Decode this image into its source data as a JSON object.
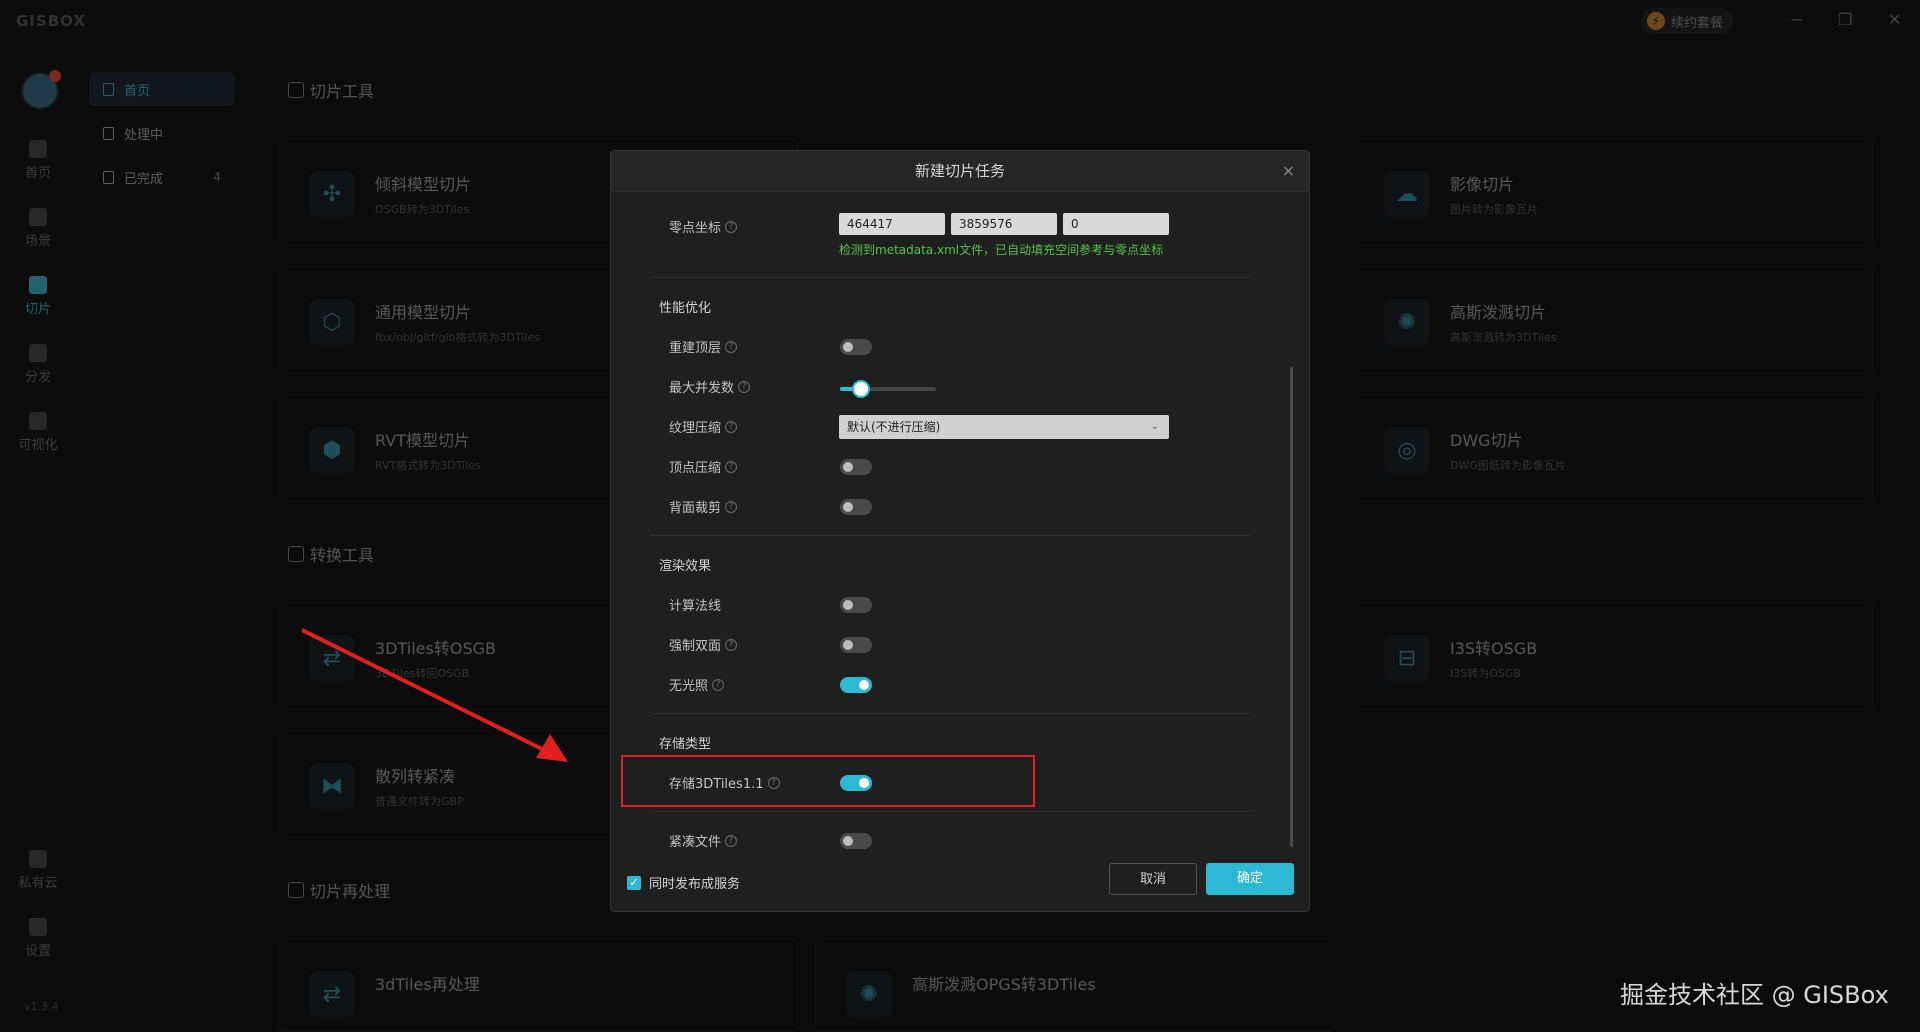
{
  "app": {
    "logo": "GISBOX",
    "package_button": "续约套餐",
    "window_controls": {
      "minimize": "−",
      "restore": "❐",
      "close": "✕"
    },
    "version": "v1.3.4"
  },
  "rail": {
    "items": [
      {
        "label": "首页",
        "icon": "home-icon"
      },
      {
        "label": "场景",
        "icon": "cube-icon"
      },
      {
        "label": "切片",
        "icon": "slice-icon",
        "active": true
      },
      {
        "label": "分发",
        "icon": "distribute-icon"
      },
      {
        "label": "可视化",
        "icon": "visualize-icon"
      }
    ],
    "bottom_items": [
      {
        "label": "私有云",
        "icon": "cloud-icon"
      },
      {
        "label": "设置",
        "icon": "gear-icon"
      }
    ]
  },
  "subnav": {
    "items": [
      {
        "label": "首页",
        "active": true
      },
      {
        "label": "处理中"
      },
      {
        "label": "已完成",
        "count": "4"
      }
    ]
  },
  "main": {
    "sections": {
      "slice_tools": "切片工具",
      "convert_tools": "转换工具",
      "reprocess": "切片再处理"
    },
    "cards": {
      "oblique": {
        "title": "倾斜模型切片",
        "sub": "OSGB转为3DTiles"
      },
      "general": {
        "title": "通用模型切片",
        "sub": "fbx/obj/gltf/glb格式转为3DTiles"
      },
      "rvt": {
        "title": "RVT模型切片",
        "sub": "RVT格式转为3DTiles"
      },
      "image": {
        "title": "影像切片",
        "sub": "图片转为影像瓦片"
      },
      "gaussian": {
        "title": "高斯泼溅切片",
        "sub": "高斯泼溅转为3DTiles"
      },
      "dwg": {
        "title": "DWG切片",
        "sub": "DWG图纸转为影像瓦片"
      },
      "tiles_to_osgb": {
        "title": "3DTiles转OSGB",
        "sub": "3DTiles转回OSGB"
      },
      "i3s": {
        "title": "I3S转OSGB",
        "sub": "I3S转为OSGB"
      },
      "scatter": {
        "title": "散列转紧凑",
        "sub": "普通文件转为GBP"
      },
      "tiles_reprocess": {
        "title": "3dTiles再处理",
        "sub": ""
      },
      "gaussian_opgs": {
        "title": "高斯泼溅OPGS转3DTiles",
        "sub": ""
      }
    }
  },
  "dialog": {
    "title": "新建切片任务",
    "close": "×",
    "origin": {
      "label": "零点坐标",
      "x": "464417",
      "y": "3859576",
      "z": "0",
      "hint": "检测到metadata.xml文件，已自动填充空间参考与零点坐标"
    },
    "perf": {
      "title": "性能优化",
      "rebuild_top": {
        "label": "重建顶层",
        "on": false
      },
      "max_concurrency": {
        "label": "最大并发数",
        "level": 0.22
      },
      "texture": {
        "label": "纹理压缩",
        "value": "默认(不进行压缩)"
      },
      "vertex": {
        "label": "顶点压缩",
        "on": false
      },
      "backface": {
        "label": "背面裁剪",
        "on": false
      }
    },
    "render": {
      "title": "渲染效果",
      "normals": {
        "label": "计算法线",
        "on": false
      },
      "double_sided": {
        "label": "强制双面",
        "on": false
      },
      "unlit": {
        "label": "无光照",
        "on": true
      }
    },
    "storage": {
      "title": "存储类型",
      "tiles11": {
        "label": "存储3DTiles1.1",
        "on": true
      },
      "compact": {
        "label": "紧凑文件",
        "on": false
      }
    },
    "publish": {
      "label": "同时发布成服务",
      "checked": true
    },
    "cancel": "取消",
    "ok": "确定"
  },
  "watermark": "掘金技术社区 @ GISBox",
  "colors": {
    "accent": "#2db8d4",
    "highlight": "#e01f1f",
    "hint": "#56c24a"
  }
}
